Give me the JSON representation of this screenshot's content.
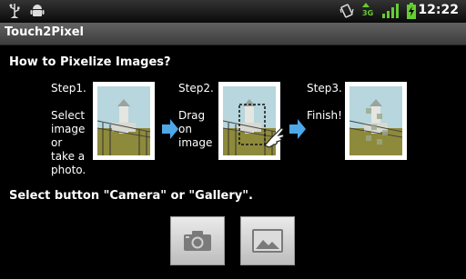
{
  "status": {
    "time": "12:22",
    "network": "3G"
  },
  "app": {
    "title": "Touch2Pixel"
  },
  "main": {
    "heading": "How to Pixelize Images?",
    "steps": [
      {
        "label": "Step1.",
        "lines": [
          "Select",
          "image",
          "or",
          "take a",
          "photo."
        ]
      },
      {
        "label": "Step2.",
        "lines": [
          "Drag",
          "on",
          "image"
        ]
      },
      {
        "label": "Step3.",
        "lines": [
          "Finish!"
        ]
      }
    ],
    "instruction": "Select button \"Camera\" or \"Gallery\"."
  },
  "buttons": {
    "camera_icon": "camera-icon",
    "gallery_icon": "gallery-icon"
  },
  "colors": {
    "arrow": "#4ea8e8",
    "title_bar": "#4f4f4f"
  }
}
